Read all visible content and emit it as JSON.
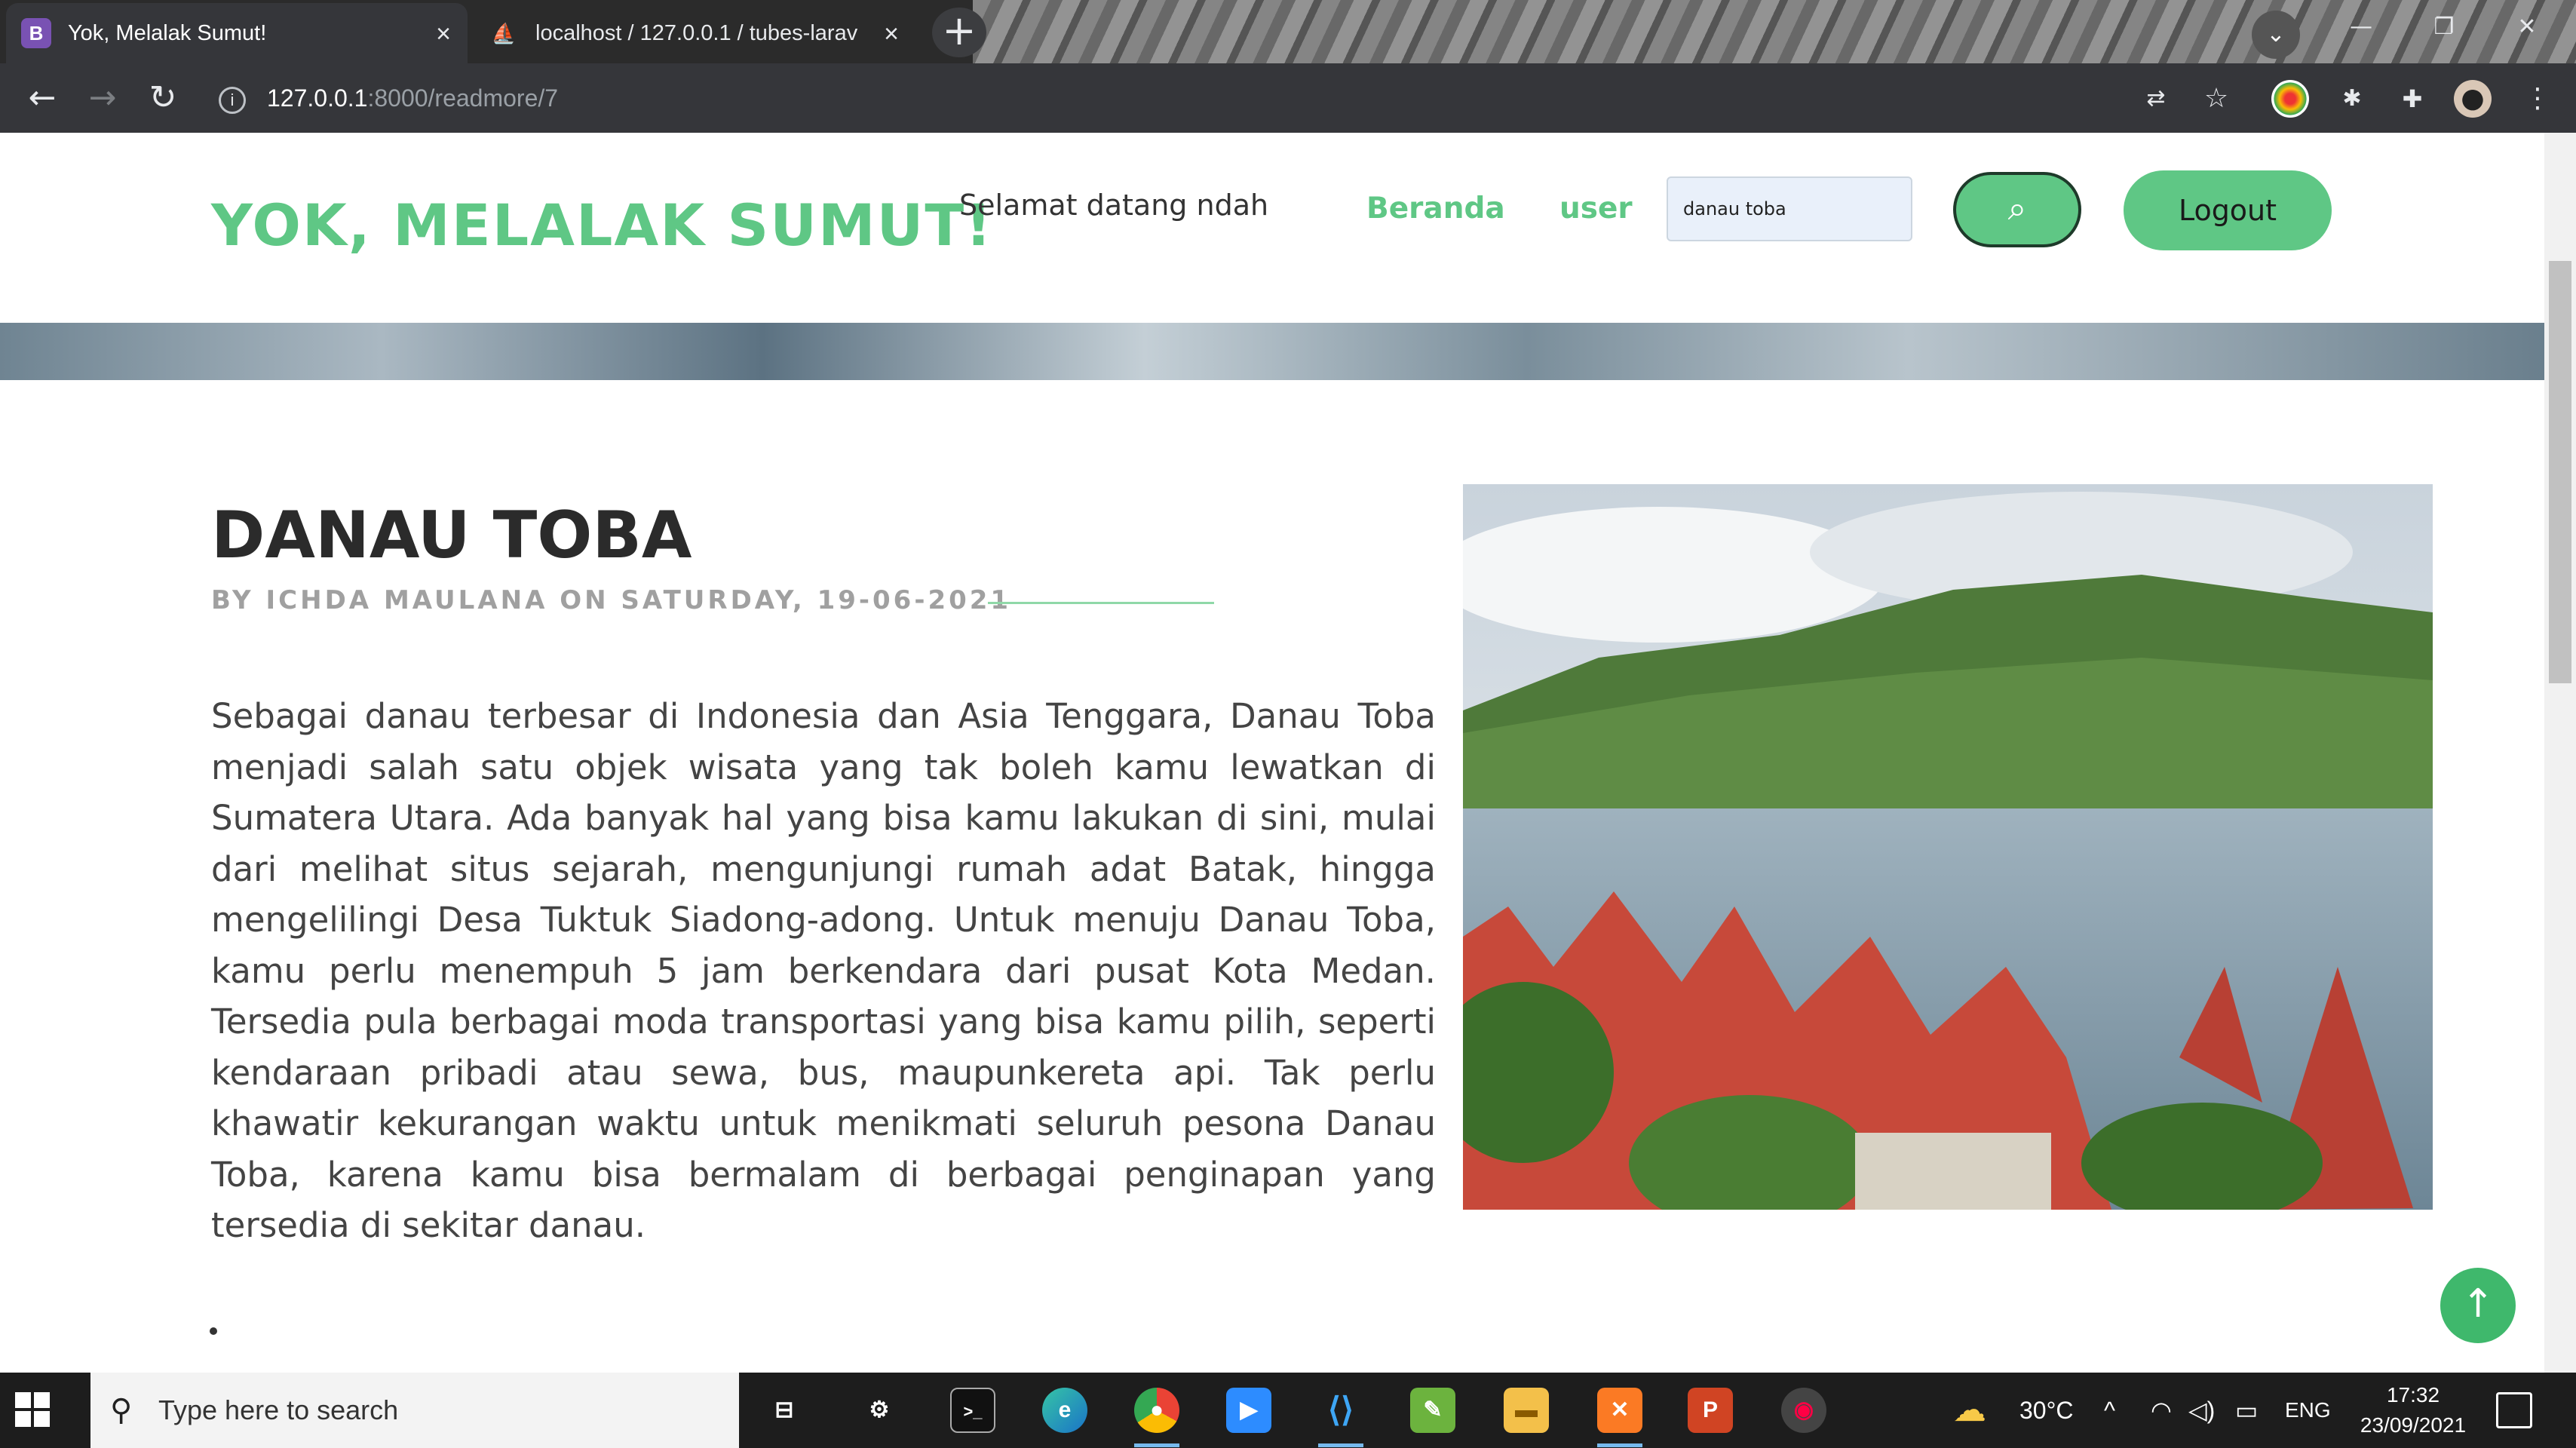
{
  "browser": {
    "tabs": [
      {
        "label": "Yok, Melalak Sumut!",
        "favicon": "B",
        "active": true
      },
      {
        "label": "localhost / 127.0.0.1 / tubes-larav",
        "favicon": "phpmyadmin-icon",
        "active": false
      }
    ],
    "url_host": "127.0.0.1",
    "url_path": ":8000/readmore/7"
  },
  "navbar": {
    "brand": "YOK, MELALAK SUMUT!",
    "welcome": "Selamat datang  ndah",
    "links": [
      "Beranda",
      "user"
    ],
    "search_value": "danau toba",
    "logout_label": "Logout"
  },
  "article": {
    "title": "DANAU TOBA",
    "byline": "BY ICHDA MAULANA ON SATURDAY, 19-06-2021",
    "body": "Sebagai danau terbesar di Indonesia dan Asia Tenggara, Danau Toba menjadi salah satu objek wisata yang tak boleh kamu lewatkan di Sumatera Utara. Ada banyak hal yang bisa kamu lakukan di sini, mulai dari melihat situs sejarah, mengunjungi rumah adat Batak, hingga mengelilingi Desa Tuktuk Siadong-adong. Untuk menuju Danau Toba, kamu perlu menempuh 5 jam berkendara dari pusat Kota Medan. Tersedia pula berbagai moda transportasi yang bisa kamu pilih, seperti kendaraan pribadi atau sewa, bus, maupunkereta api. Tak perlu khawatir kekurangan waktu untuk menikmati seluruh pesona Danau Toba, karena kamu bisa bermalam di berbagai penginapan yang tersedia di sekitar danau."
  },
  "colors": {
    "accent": "#5fc785",
    "dark": "#2b2b2b"
  },
  "taskbar": {
    "search_placeholder": "Type here to search",
    "temperature": "30°C",
    "language": "ENG",
    "time": "17:32",
    "date": "23/09/2021"
  }
}
